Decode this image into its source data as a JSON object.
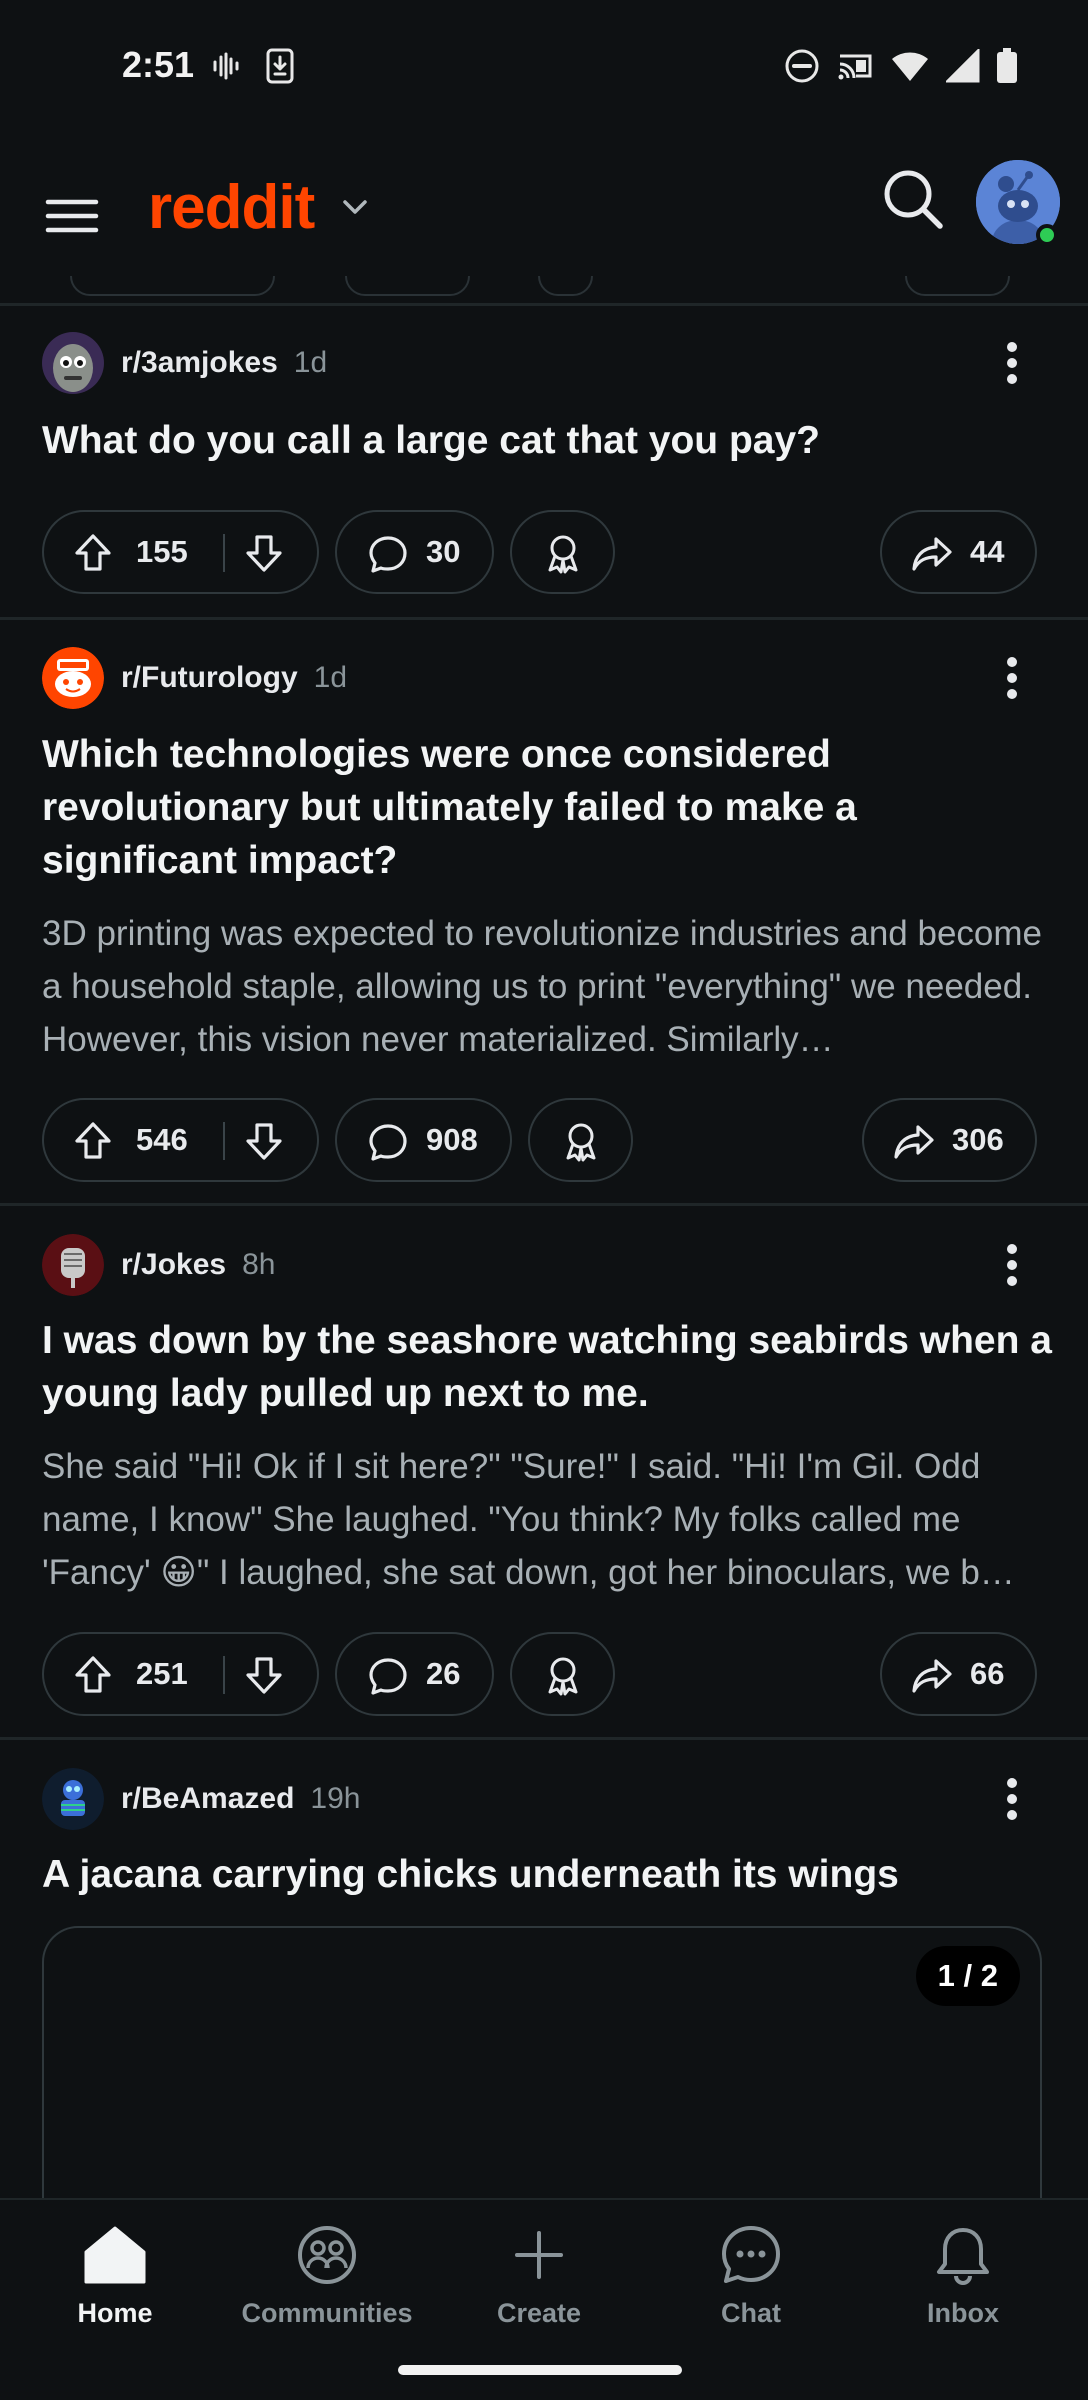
{
  "status_bar": {
    "time": "2:51",
    "left_icons": [
      "voicemail-icon",
      "download-icon"
    ],
    "right_icons": [
      "do-not-disturb-icon",
      "cast-icon",
      "wifi-icon",
      "cellular-signal-icon",
      "battery-icon"
    ]
  },
  "header": {
    "logo_text": "reddit",
    "menu_icon": "hamburger-menu-icon",
    "search_icon": "search-icon",
    "avatar_status": "online"
  },
  "posts": [
    {
      "subreddit": "r/3amjokes",
      "age": "1d",
      "title": "What do you call a large cat that you pay?",
      "body": "",
      "upvotes": "155",
      "comments": "30",
      "shares": "44"
    },
    {
      "subreddit": "r/Futurology",
      "age": "1d",
      "title": "Which technologies were once considered revolutionary but ultimately failed to make a significant impact?",
      "body": "3D printing was expected to revolutionize industries and become a household staple, allowing us to print \"everything\" we needed. However, this vision never materialized. Similarly…",
      "upvotes": "546",
      "comments": "908",
      "shares": "306"
    },
    {
      "subreddit": "r/Jokes",
      "age": "8h",
      "title": "I was down by the seashore watching seabirds when a young lady pulled up next to me.",
      "body": "She said \"Hi! Ok if I sit here?\" \"Sure!\" I said. \"Hi! I'm Gil. Odd name, I know\" She laughed. \"You think? My folks called me 'Fancy' 😀\" I laughed, she sat down, got her binoculars, we b…",
      "upvotes": "251",
      "comments": "26",
      "shares": "66"
    },
    {
      "subreddit": "r/BeAmazed",
      "age": "19h",
      "title": "A jacana carrying chicks underneath its wings",
      "media_counter": "1 / 2"
    }
  ],
  "bottom_nav": {
    "items": [
      {
        "label": "Home",
        "icon": "home-icon",
        "active": true
      },
      {
        "label": "Communities",
        "icon": "communities-icon",
        "active": false
      },
      {
        "label": "Create",
        "icon": "plus-icon",
        "active": false
      },
      {
        "label": "Chat",
        "icon": "chat-icon",
        "active": false
      },
      {
        "label": "Inbox",
        "icon": "bell-icon",
        "active": false
      }
    ]
  },
  "colors": {
    "background": "#0e1113",
    "brand": "#ff4500",
    "online": "#2ecc55",
    "avatar": "#5b84d6"
  }
}
